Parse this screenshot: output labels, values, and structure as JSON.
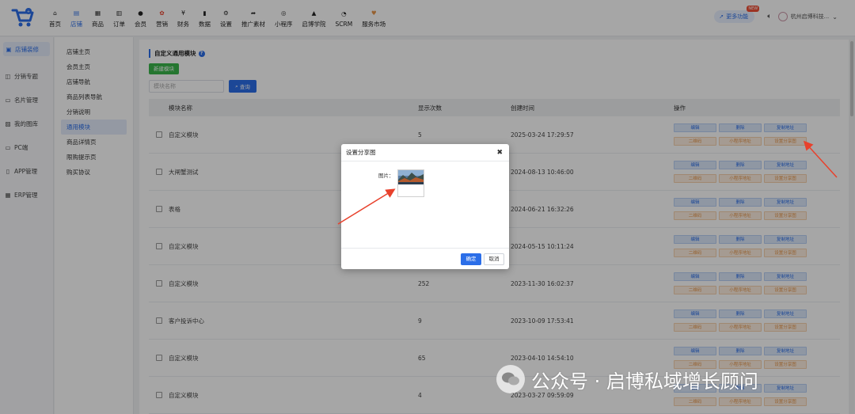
{
  "nav": [
    {
      "label": "首页",
      "icon": "home-icon"
    },
    {
      "label": "店铺",
      "icon": "store-icon"
    },
    {
      "label": "商品",
      "icon": "goods-icon"
    },
    {
      "label": "订单",
      "icon": "order-icon"
    },
    {
      "label": "会员",
      "icon": "member-icon"
    },
    {
      "label": "营销",
      "icon": "marketing-icon"
    },
    {
      "label": "财务",
      "icon": "finance-icon"
    },
    {
      "label": "数据",
      "icon": "data-icon"
    },
    {
      "label": "设置",
      "icon": "settings-icon"
    },
    {
      "label": "推广素材",
      "icon": "share-icon"
    },
    {
      "label": "小程序",
      "icon": "miniprogram-icon"
    },
    {
      "label": "启博学院",
      "icon": "academy-icon"
    },
    {
      "label": "SCRM",
      "icon": "scrm-icon"
    },
    {
      "label": "服务市场",
      "icon": "service-market-icon"
    }
  ],
  "top_right": {
    "more_label": "更多功能",
    "new_badge": "NEW",
    "company": "杭州启博科技..."
  },
  "sidebar": [
    {
      "label": "店铺装修"
    },
    {
      "label": "分销专题"
    },
    {
      "label": "名片管理"
    },
    {
      "label": "我的图库"
    },
    {
      "label": "PC端"
    },
    {
      "label": "APP管理"
    },
    {
      "label": "ERP管理"
    }
  ],
  "subnav": [
    {
      "label": "店铺主页"
    },
    {
      "label": "会员主页"
    },
    {
      "label": "店铺导航"
    },
    {
      "label": "商品列表导航"
    },
    {
      "label": "分销说明"
    },
    {
      "label": "通用模块"
    },
    {
      "label": "商品详情页"
    },
    {
      "label": "限购提示页"
    },
    {
      "label": "购买协议"
    }
  ],
  "page": {
    "section_title": "自定义通用模块",
    "new_button": "新建模块",
    "search_placeholder": "模块名称",
    "search_button": "查询"
  },
  "table": {
    "headers": [
      "模块名称",
      "显示次数",
      "创建时间",
      "操作"
    ],
    "ops": {
      "edit": "编辑",
      "delete": "删除",
      "copy_url": "复制地址",
      "qrcode": "二维码",
      "mini_url": "小程序地址",
      "share_img": "设置分享图"
    },
    "rows": [
      {
        "name": "自定义模块",
        "count": "5",
        "time": "2025-03-24 17:29:57"
      },
      {
        "name": "大闸蟹测试",
        "count": "",
        "time": "2024-08-13 10:46:00"
      },
      {
        "name": "表格",
        "count": "",
        "time": "2024-06-21 16:32:26"
      },
      {
        "name": "自定义模块",
        "count": "",
        "time": "2024-05-15 10:11:24"
      },
      {
        "name": "自定义模块",
        "count": "252",
        "time": "2023-11-30 16:02:37"
      },
      {
        "name": "客户投诉中心",
        "count": "9",
        "time": "2023-10-09 17:53:41"
      },
      {
        "name": "自定义模块",
        "count": "65",
        "time": "2023-04-10 14:54:10"
      },
      {
        "name": "自定义模块",
        "count": "4",
        "time": "2023-03-27 09:59:09"
      }
    ]
  },
  "modal": {
    "title": "设置分享图",
    "close": "✖",
    "image_label": "图片：",
    "ok": "确定",
    "cancel": "取消"
  },
  "watermark": {
    "text": "公众号 · 启博私域增长顾问"
  },
  "colors": {
    "primary": "#2b6ee8",
    "green": "#39b54a",
    "orange": "#e6964a",
    "arrow": "#e8412c"
  }
}
